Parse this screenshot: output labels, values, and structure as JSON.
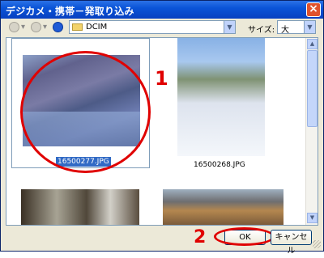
{
  "window": {
    "title": "デジカメ・携帯－発取り込み"
  },
  "toolbar": {
    "path_value": "DCIM",
    "size_label": "サイズ:",
    "size_value": "大"
  },
  "thumbnails": [
    {
      "filename": "16500277.JPG",
      "selected": true
    },
    {
      "filename": "16500268.JPG",
      "selected": false
    },
    {
      "filename": "",
      "selected": false
    },
    {
      "filename": "",
      "selected": false
    }
  ],
  "annotations": {
    "step1": "1",
    "step2": "2"
  },
  "buttons": {
    "ok": "OK",
    "cancel": "キャンセル"
  },
  "icons": [
    "back-icon",
    "forward-icon",
    "up-icon",
    "folder-icon",
    "chevron-down-icon",
    "close-icon",
    "size-grip-icon"
  ],
  "colors": {
    "annotation_red": "#e00000",
    "titlebar_blue": "#0a54d8",
    "selection_blue": "#316ac5"
  }
}
